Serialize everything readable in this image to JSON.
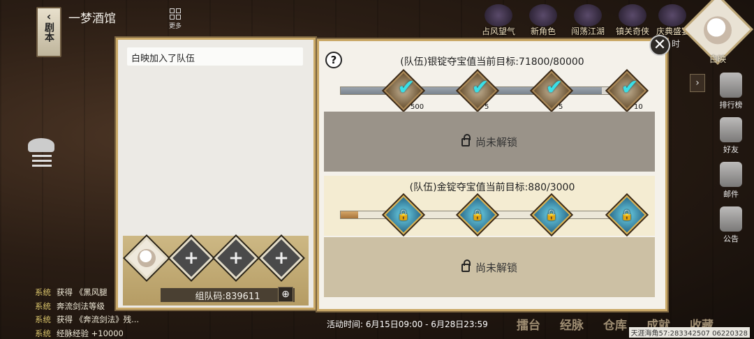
{
  "header": {
    "scroll_tab_label": "剧本",
    "tavern_title": "一梦酒馆",
    "more_label": "更多",
    "activities": [
      "占风望气",
      "新角色",
      "闯荡江湖",
      "镇关奇侠",
      "庆典盛宴"
    ],
    "player_name": "白映",
    "timer_suffix": "时"
  },
  "right_menu": [
    "排行榜",
    "好友",
    "邮件",
    "公告"
  ],
  "team": {
    "message": "白映加入了队伍",
    "team_code": "组队码:839611",
    "slots": [
      "filled",
      "empty",
      "empty",
      "empty"
    ]
  },
  "silver": {
    "title": "(队伍)银锭夺宝值当前目标:71800/80000",
    "progress": 0.9,
    "rewards": [
      {
        "qty": "500",
        "claimed": true
      },
      {
        "qty": "5",
        "claimed": true
      },
      {
        "qty": "5",
        "claimed": true
      },
      {
        "qty": "10",
        "claimed": true
      }
    ],
    "locked_text": "尚未解锁"
  },
  "gold": {
    "title": "(队伍)金锭夺宝值当前目标:880/3000",
    "progress": 0.06,
    "rewards": [
      {
        "locked": true
      },
      {
        "locked": true
      },
      {
        "locked": true
      },
      {
        "locked": true
      }
    ],
    "locked_text": "尚未解锁"
  },
  "activity_time": "活动时间: 6月15日09:00 - 6月28日23:59",
  "chat": [
    {
      "tag": "系统",
      "msg": "获得 《黑风腿"
    },
    {
      "tag": "系统",
      "msg": "奔流剑法等级"
    },
    {
      "tag": "系统",
      "msg": "获得 《奔流剑法》残..."
    },
    {
      "tag": "系统",
      "msg": "经脉经验 +10000"
    }
  ],
  "bottom_nav": [
    "擂台",
    "经脉",
    "仓库",
    "成就",
    "收藏"
  ],
  "watermark": "天涯海角57:283342507 06220328",
  "colors": {
    "panel_border": "#caa968",
    "check": "#3ae0e8"
  }
}
